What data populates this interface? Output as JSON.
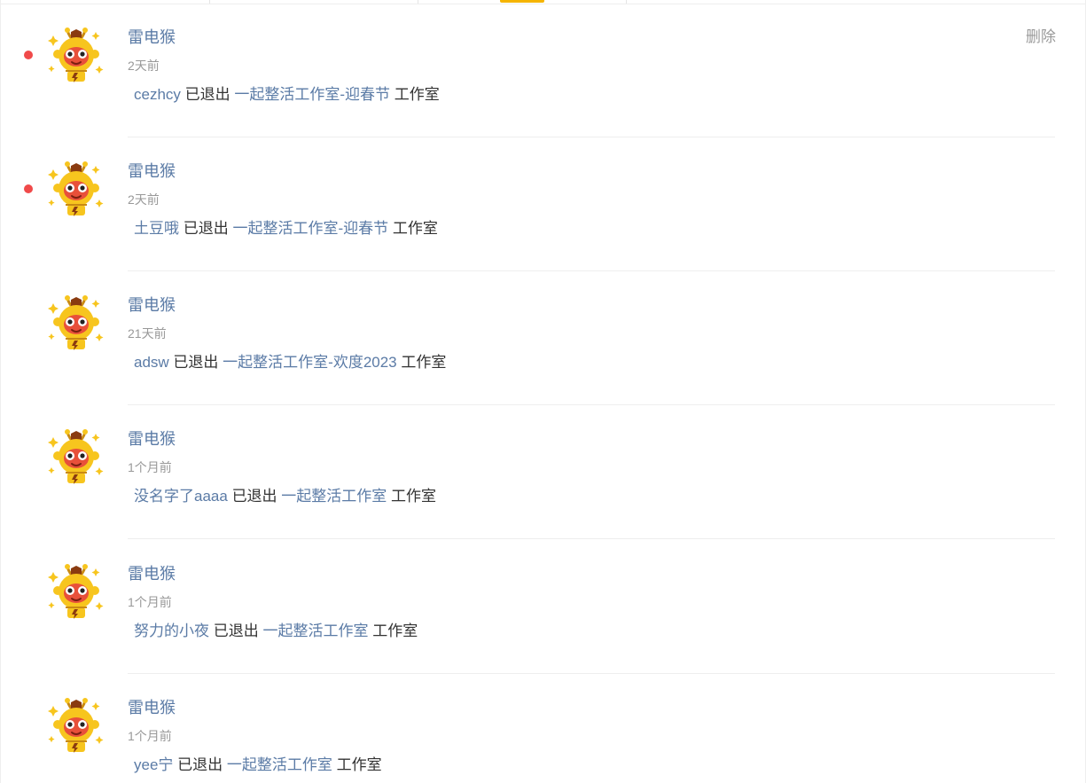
{
  "colors": {
    "link": "#5b7ba6",
    "text": "#333333",
    "muted": "#999999",
    "unread_dot": "#f04a4a",
    "tab_indicator": "#f5b400"
  },
  "avatar": {
    "icon": "monkey-mascot-icon"
  },
  "delete_label": "删除",
  "messages": [
    {
      "sender": "雷电猴",
      "time": "2天前",
      "user": "cezhcy",
      "action": "已退出",
      "studio": "一起整活工作室-迎春节",
      "suffix": "工作室",
      "unread": true
    },
    {
      "sender": "雷电猴",
      "time": "2天前",
      "user": "土豆哦",
      "action": "已退出",
      "studio": "一起整活工作室-迎春节",
      "suffix": "工作室",
      "unread": true
    },
    {
      "sender": "雷电猴",
      "time": "21天前",
      "user": "adsw",
      "action": "已退出",
      "studio": "一起整活工作室-欢度2023",
      "suffix": "工作室",
      "unread": false
    },
    {
      "sender": "雷电猴",
      "time": "1个月前",
      "user": "没名字了aaaa",
      "action": "已退出",
      "studio": "一起整活工作室",
      "suffix": "工作室",
      "unread": false
    },
    {
      "sender": "雷电猴",
      "time": "1个月前",
      "user": "努力的小夜",
      "action": "已退出",
      "studio": "一起整活工作室",
      "suffix": "工作室",
      "unread": false
    },
    {
      "sender": "雷电猴",
      "time": "1个月前",
      "user": "yee宁",
      "action": "已退出",
      "studio": "一起整活工作室",
      "suffix": "工作室",
      "unread": false
    }
  ]
}
